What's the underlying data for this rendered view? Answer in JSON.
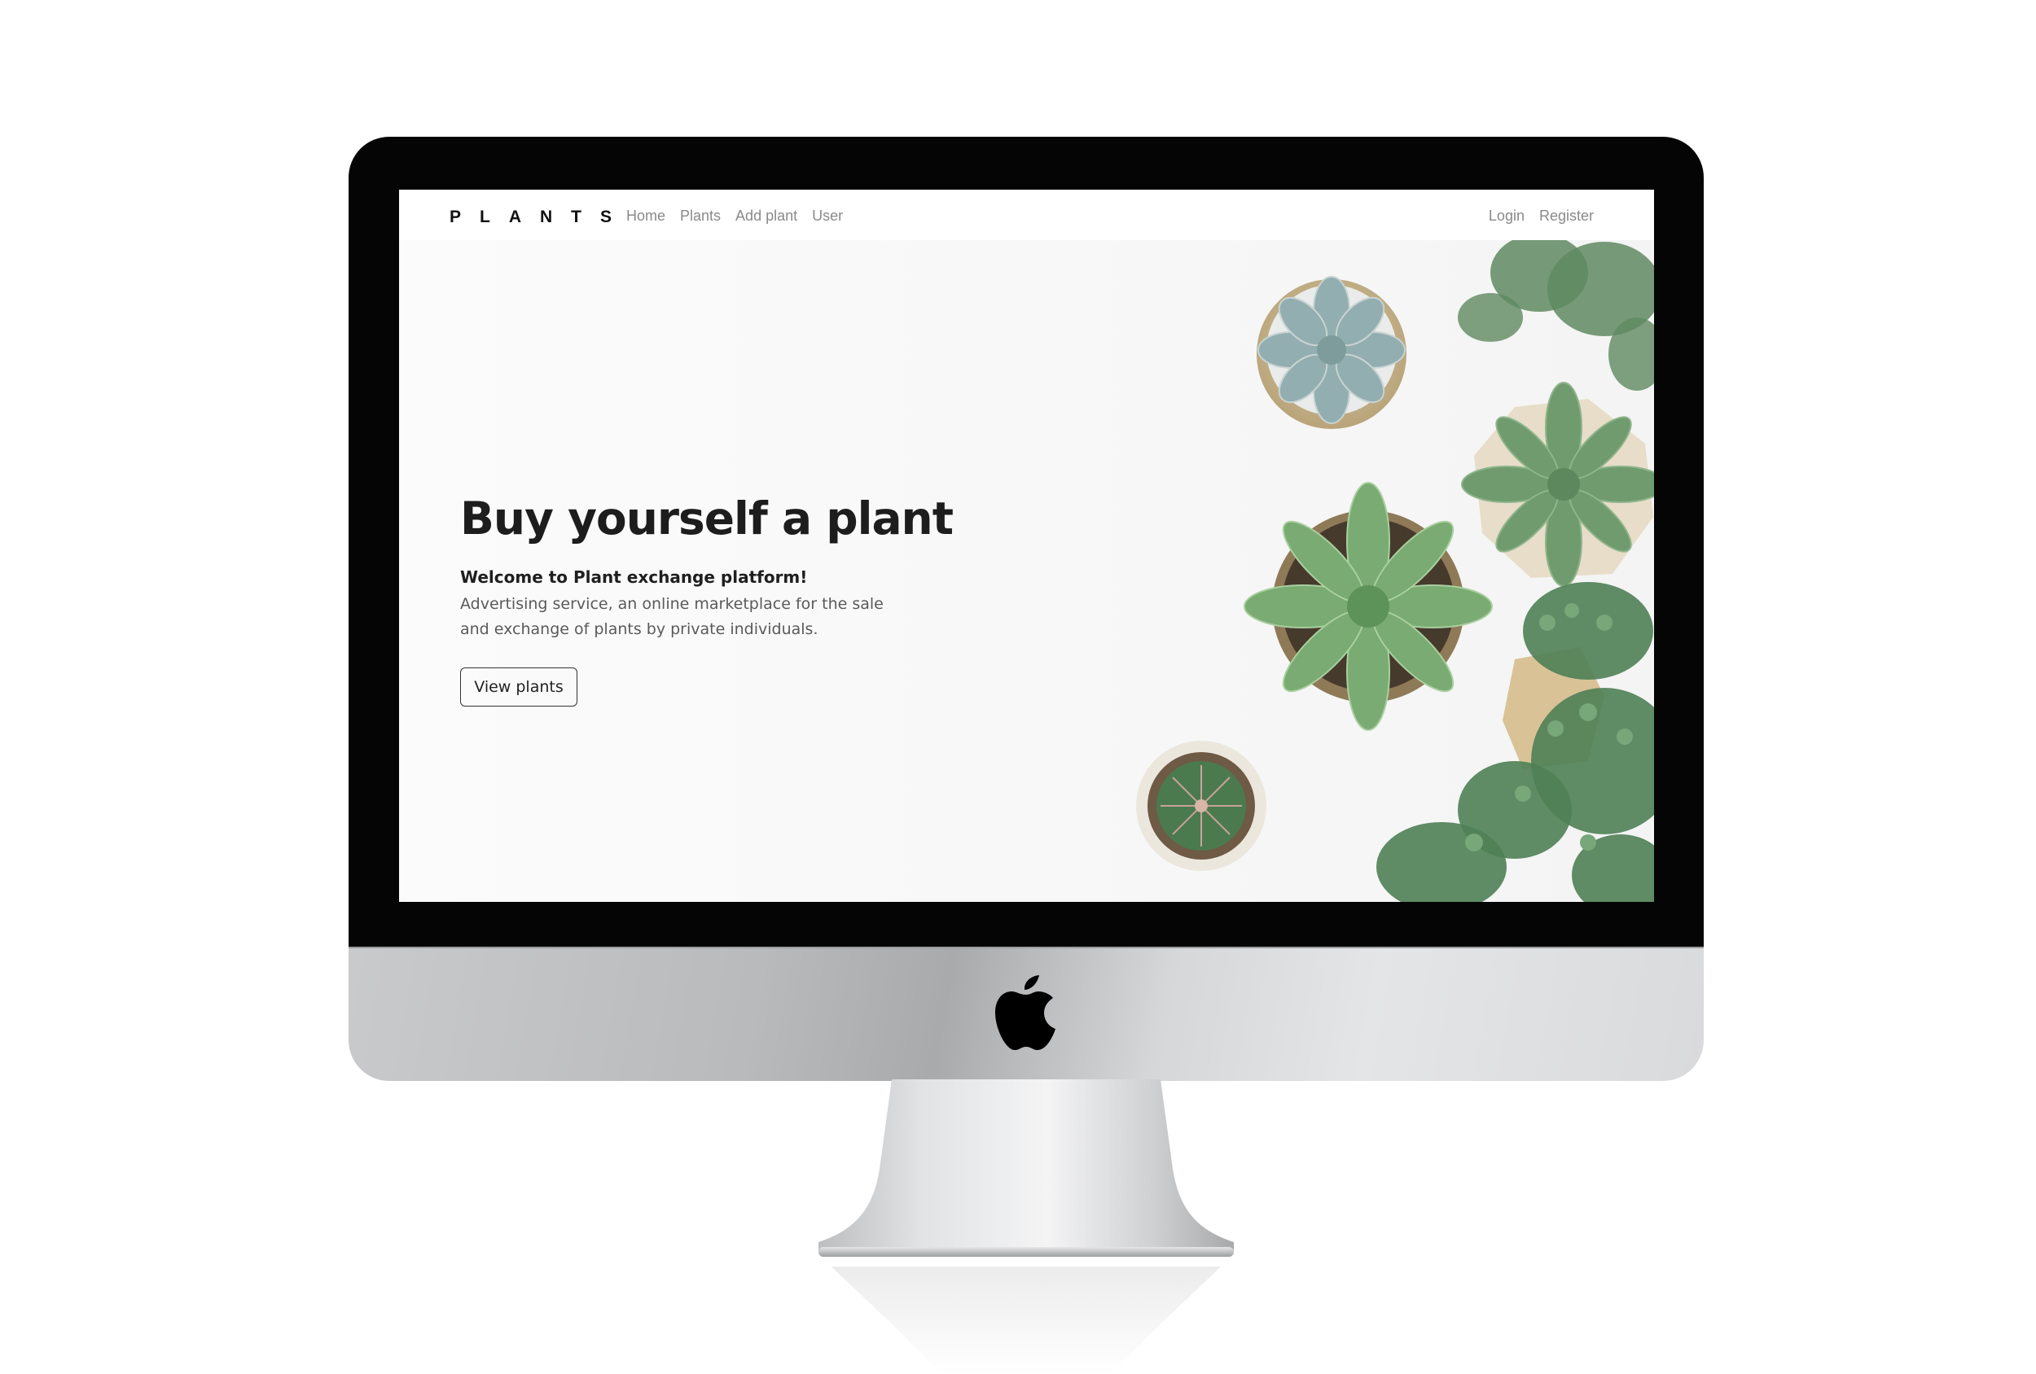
{
  "brand": "PLANTS",
  "nav": {
    "links": [
      "Home",
      "Plants",
      "Add plant",
      "User"
    ],
    "right": [
      "Login",
      "Register"
    ]
  },
  "hero": {
    "title": "Buy yourself a plant",
    "lead": "Welcome to Plant exchange platform!",
    "description": "Advertising service, an online marketplace for the sale and exchange of plants by private individuals.",
    "button": "View plants"
  },
  "device": {
    "logo_icon": "apple-logo-icon",
    "bezel_color": "#050505",
    "chin_color": "#c9cacc"
  },
  "colors": {
    "text_dark": "#1d1d1d",
    "nav_text": "#8a8a8a",
    "plant_green": "#6e9a72",
    "succulent_blue": "#9bb2ae"
  }
}
